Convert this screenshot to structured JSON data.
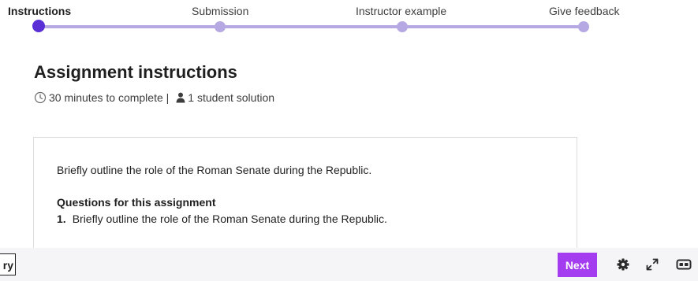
{
  "stepper": {
    "steps": [
      {
        "label": "Instructions",
        "active": true
      },
      {
        "label": "Submission",
        "active": false
      },
      {
        "label": "Instructor example",
        "active": false
      },
      {
        "label": "Give feedback",
        "active": false
      }
    ]
  },
  "header": {
    "title": "Assignment instructions",
    "duration": "30 minutes to complete |",
    "solutions": "1 student solution"
  },
  "card": {
    "prompt": "Briefly outline the role of the Roman Senate during the Republic.",
    "questions_heading": "Questions for this assignment",
    "questions": [
      {
        "number": "1.",
        "text": "Briefly outline the role of the Roman Senate during the Republic."
      }
    ]
  },
  "footer": {
    "prev_label": "ry",
    "next_label": "Next",
    "icons": [
      "gear-icon",
      "expand-icon",
      "caption-icon"
    ]
  },
  "colors": {
    "accent": "#5a2fd6",
    "track": "#b5a8e3",
    "next_button": "#a43df0"
  }
}
